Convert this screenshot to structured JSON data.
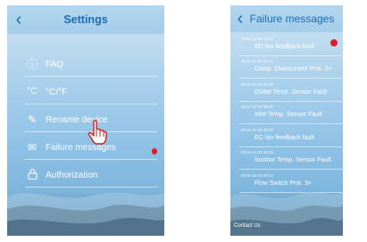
{
  "settings_screen": {
    "title": "Settings",
    "back_icon": "chevron-left-icon",
    "menu": [
      {
        "icon": "info-icon",
        "glyph": "ⓘ",
        "label": "FAQ"
      },
      {
        "icon": "temperature-unit-icon",
        "glyph": "°C",
        "label": "°C/°F"
      },
      {
        "icon": "pencil-icon",
        "glyph": "✎",
        "label": "Rename device"
      },
      {
        "icon": "envelope-icon",
        "glyph": "✉",
        "label": "Failure messages",
        "badge": true
      },
      {
        "icon": "lock-icon",
        "glyph": "🔒",
        "label": "Authorization"
      }
    ]
  },
  "failure_screen": {
    "title": "Failure messages",
    "back_icon": "chevron-left-icon",
    "messages": [
      {
        "time": "2016-12-22 15:41",
        "text": "EC fan feedback fault",
        "badge": true
      },
      {
        "time": "2016-12-22 10:11",
        "text": "Comp. Overcurrent Prot. 3+"
      },
      {
        "time": "2016-12-22 09:38",
        "text": "Outlet Temp. Sensor Fault"
      },
      {
        "time": "2016-12-22 09:37",
        "text": "Inlet Temp. Sensor Fault"
      },
      {
        "time": "2016-12-22 09:37",
        "text": "EC fan feedback fault"
      },
      {
        "time": "2016-12-22 09:12",
        "text": "Suction Temp. Sensor Fault"
      },
      {
        "time": "2016-12-22 09:12",
        "text": "Flow Switch Prot. 3+"
      }
    ],
    "contact_label": "Contact Us"
  },
  "colors": {
    "accent": "#1d6db4",
    "badge": "#dd1f2b",
    "background_top": "#cfe4f3",
    "background_bottom": "#7fb6dd"
  }
}
